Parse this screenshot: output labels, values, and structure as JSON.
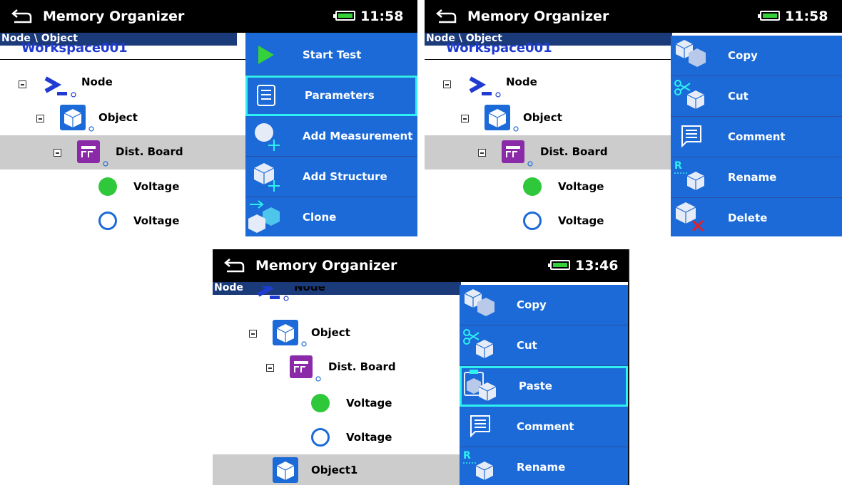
{
  "screens": [
    {
      "title": "Memory Organizer",
      "time": "11:58",
      "path": "Node \\ Object",
      "workspace": "Workspace001",
      "tree": [
        "Node",
        "Object",
        "Dist. Board",
        "Voltage",
        "Voltage"
      ],
      "menu": [
        "Start Test",
        "Parameters",
        "Add Measurement",
        "Add Structure",
        "Clone"
      ],
      "selected_menu": "Parameters"
    },
    {
      "title": "Memory Organizer",
      "time": "11:58",
      "path": "Node \\ Object",
      "workspace": "Workspace001",
      "tree": [
        "Node",
        "Object",
        "Dist. Board",
        "Voltage",
        "Voltage"
      ],
      "menu": [
        "Copy",
        "Cut",
        "Comment",
        "Rename",
        "Delete"
      ]
    },
    {
      "title": "Memory Organizer",
      "time": "13:46",
      "path": "Node",
      "tree": [
        "Node",
        "Object",
        "Dist. Board",
        "Voltage",
        "Voltage",
        "Object1"
      ],
      "menu": [
        "Copy",
        "Cut",
        "Paste",
        "Comment",
        "Rename"
      ],
      "selected_menu": "Paste"
    }
  ],
  "colors": {
    "titlebar": "#000000",
    "menu": "#1b6ad8",
    "menu_selected_border": "#2ef0f0",
    "path_bar": "#1b3a7a",
    "selected_row": "#cccccc",
    "battery": "#36d13a",
    "node_icon": "#1f3bd1",
    "object_icon": "#1b6ad8",
    "board_icon": "#8a2aa8",
    "voltage_filled": "#2ec83a",
    "voltage_empty": "#1b6ad8",
    "delete_x": "#e0202a"
  },
  "icons": [
    "back-icon",
    "battery-icon",
    "node-icon",
    "object-icon",
    "dist-board-icon",
    "voltage-pass-icon",
    "voltage-empty-icon",
    "play-icon",
    "parameters-icon",
    "add-measurement-icon",
    "add-structure-icon",
    "clone-icon",
    "copy-icon",
    "cut-icon",
    "paste-icon",
    "comment-icon",
    "rename-icon",
    "delete-icon"
  ]
}
